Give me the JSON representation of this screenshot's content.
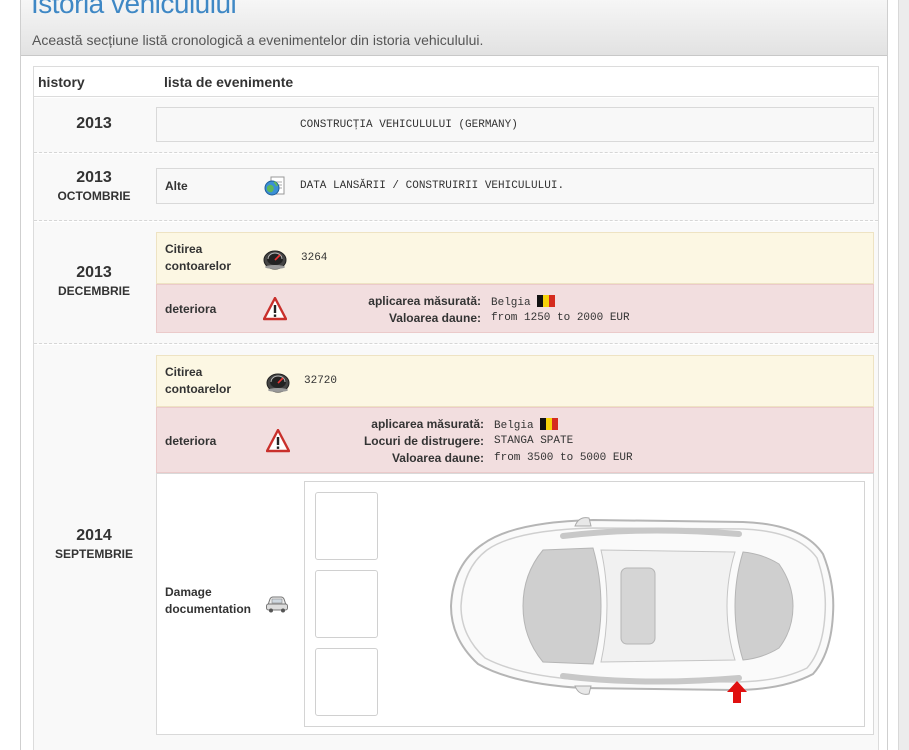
{
  "section": {
    "title": "Istoria vehiculului",
    "subtitle": "Această secțiune listă cronologică a evenimentelor din istoria vehiculului."
  },
  "table": {
    "col_history": "history",
    "col_events": "lista de evenimente"
  },
  "rows": [
    {
      "year": "2013",
      "month": "",
      "events": [
        {
          "label": "",
          "text": "CONSTRUCȚIA VEHICULULUI (GERMANY)",
          "style": "plain"
        }
      ]
    },
    {
      "year": "2013",
      "month": "OCTOMBRIE",
      "events": [
        {
          "label": "Alte",
          "icon": "globe-document-icon",
          "text": "DATA LANSĂRII / CONSTRUIRII VEHICULULUI.",
          "style": "plain"
        }
      ]
    },
    {
      "year": "2013",
      "month": "DECEMBRIE",
      "events": [
        {
          "label_line1": "Citirea",
          "label_line2": "contoarelor",
          "icon": "speedometer-icon",
          "text": "3264",
          "style": "yellow"
        },
        {
          "label": "deteriora",
          "icon": "warning-icon",
          "style": "red",
          "fields": [
            {
              "key": "aplicarea măsurată:",
              "value": "Belgia",
              "flag": "belgium-flag-icon"
            },
            {
              "key": "Valoarea daune:",
              "value": "from 1250 to 2000 EUR"
            }
          ]
        }
      ]
    },
    {
      "year": "2014",
      "month": "SEPTEMBRIE",
      "events": [
        {
          "label_line1": "Citirea",
          "label_line2": "contoarelor",
          "icon": "speedometer-icon",
          "text": "32720",
          "style": "yellow"
        },
        {
          "label": "deteriora",
          "icon": "warning-icon",
          "style": "red",
          "fields": [
            {
              "key": "aplicarea măsurată:",
              "value": "Belgia",
              "flag": "belgium-flag-icon"
            },
            {
              "key": "Locuri de distrugere:",
              "value": "STANGA SPATE"
            },
            {
              "key": "Valoarea daune:",
              "value": "from 3500 to 5000 EUR"
            }
          ]
        },
        {
          "label_line1": "Damage",
          "label_line2": "documentation",
          "icon": "car-icon",
          "style": "white",
          "damage_marker": "red-arrow-icon"
        }
      ]
    }
  ],
  "colors": {
    "title": "#3f88c5",
    "meter_bg": "#fcf7e3",
    "damage_bg": "#f2dedf",
    "damage_marker": "#e01010"
  }
}
